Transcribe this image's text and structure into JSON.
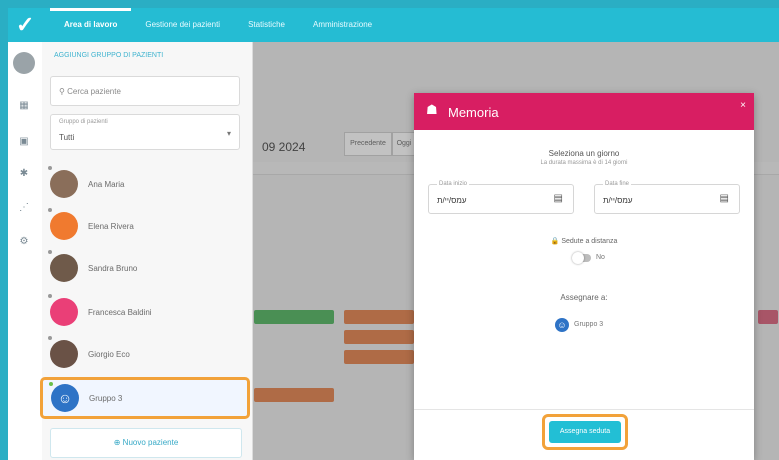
{
  "nav": {
    "tabs": [
      "Area di lavoro",
      "Gestione dei pazienti",
      "Statistiche",
      "Amministrazione"
    ]
  },
  "sidebar": {
    "link": "AGGIUNGI GRUPPO DI PAZIENTI",
    "search_placeholder": "Cerca paziente",
    "filter_label": "Gruppo di pazienti",
    "filter_value": "Tutti",
    "patients": [
      {
        "name": "Ana Maria"
      },
      {
        "name": "Elena Rivera"
      },
      {
        "name": "Sandra Bruno"
      },
      {
        "name": "Francesca Baldini"
      },
      {
        "name": "Giorgio Eco"
      },
      {
        "name": "Gruppo 3"
      }
    ],
    "add_button": "Nuovo paziente"
  },
  "calendar": {
    "date_title": "09 2024",
    "controls": [
      "Precedente",
      "Oggi"
    ]
  },
  "modal": {
    "title": "Memoria",
    "select_day": "Seleziona un giorno",
    "select_sub": "La durata massima è di 14 giorni",
    "start_label": "Data inizio",
    "start_value": "עמס/יי/ת",
    "end_label": "Data fine",
    "end_value": "עמס/יי/ת",
    "switch_label": "Sedute a distanza",
    "switch_value": "No",
    "assign_title": "Assegnare a:",
    "assignee": "Gruppo 3",
    "assign_button": "Assegna seduta"
  },
  "colors": {
    "accent": "#25bcd3",
    "modal_header": "#d81e62",
    "highlight": "#f2a23a"
  }
}
